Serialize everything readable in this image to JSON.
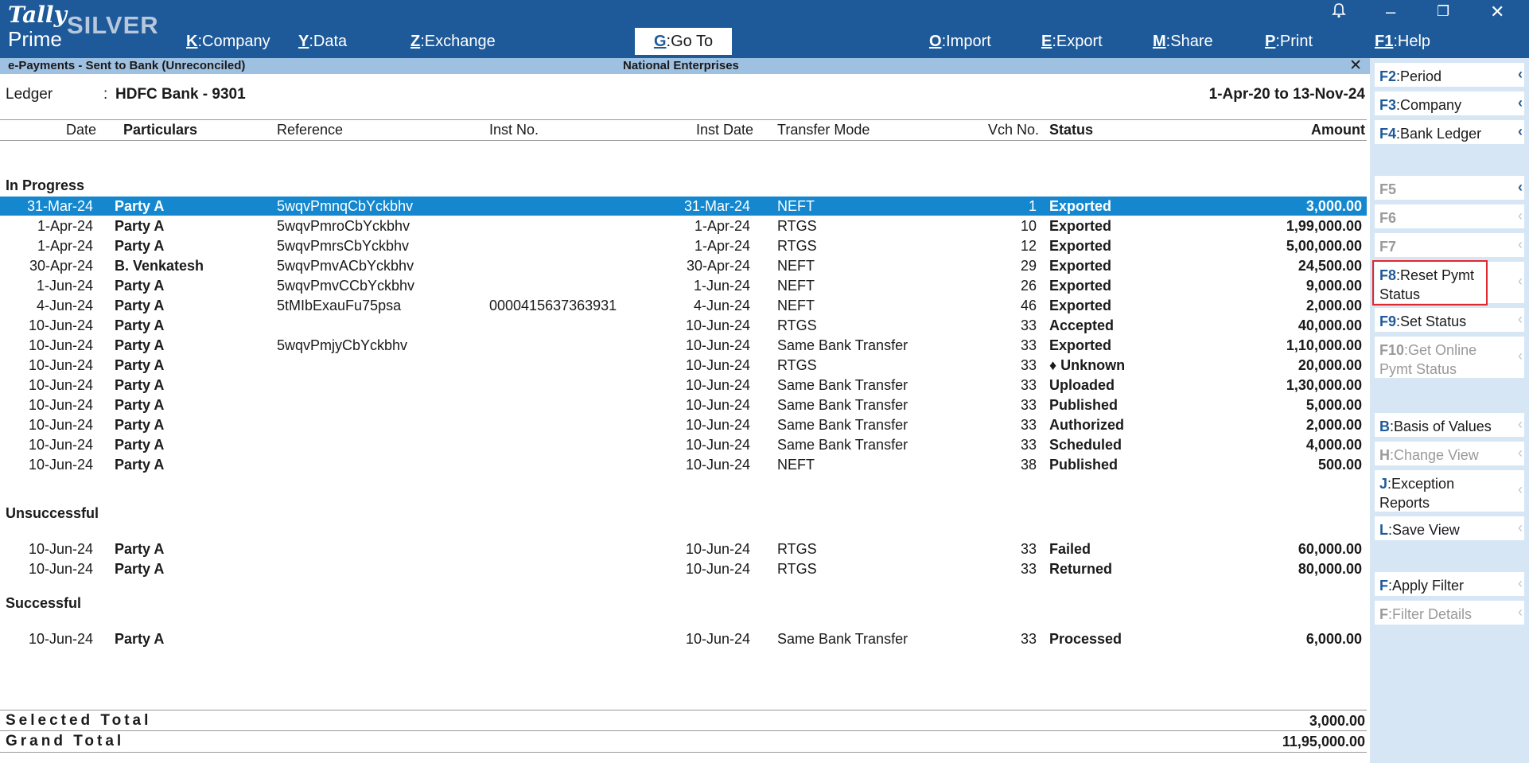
{
  "topbar": {
    "logo_tally": "Tally",
    "logo_prime": "Prime",
    "edition": "SILVER",
    "menu": [
      {
        "key": "K",
        "label": "Company"
      },
      {
        "key": "Y",
        "label": "Data"
      },
      {
        "key": "Z",
        "label": "Exchange"
      },
      {
        "key": "O",
        "label": "Import"
      },
      {
        "key": "E",
        "label": "Export"
      },
      {
        "key": "M",
        "label": "Share"
      },
      {
        "key": "P",
        "label": "Print"
      },
      {
        "key": "F1",
        "label": "Help"
      }
    ],
    "goto": {
      "key": "G",
      "label": "Go To"
    }
  },
  "titlebar": {
    "report_name": "e-Payments - Sent to Bank (Unreconciled)",
    "company": "National Enterprises"
  },
  "ledger": {
    "label": "Ledger",
    "sep": ":",
    "name": "HDFC Bank - 9301",
    "period": "1-Apr-20 to 13-Nov-24"
  },
  "columns": {
    "date": "Date",
    "particulars": "Particulars",
    "reference": "Reference",
    "inst_no": "Inst No.",
    "inst_date": "Inst Date",
    "transfer_mode": "Transfer Mode",
    "vch_no": "Vch No.",
    "status": "Status",
    "amount": "Amount"
  },
  "sections": {
    "in_progress": {
      "title": "In Progress",
      "rows": [
        {
          "date": "31-Mar-24",
          "party": "Party A",
          "ref": "5wqvPmnqCbYckbhv",
          "inst_no": "",
          "inst_date": "31-Mar-24",
          "mode": "NEFT",
          "vch": "1",
          "status": "Exported",
          "amount": "3,000.00"
        },
        {
          "date": "1-Apr-24",
          "party": "Party A",
          "ref": "5wqvPmroCbYckbhv",
          "inst_no": "",
          "inst_date": "1-Apr-24",
          "mode": "RTGS",
          "vch": "10",
          "status": "Exported",
          "amount": "1,99,000.00"
        },
        {
          "date": "1-Apr-24",
          "party": "Party A",
          "ref": "5wqvPmrsCbYckbhv",
          "inst_no": "",
          "inst_date": "1-Apr-24",
          "mode": "RTGS",
          "vch": "12",
          "status": "Exported",
          "amount": "5,00,000.00"
        },
        {
          "date": "30-Apr-24",
          "party": "B. Venkatesh",
          "ref": "5wqvPmvACbYckbhv",
          "inst_no": "",
          "inst_date": "30-Apr-24",
          "mode": "NEFT",
          "vch": "29",
          "status": "Exported",
          "amount": "24,500.00"
        },
        {
          "date": "1-Jun-24",
          "party": "Party A",
          "ref": "5wqvPmvCCbYckbhv",
          "inst_no": "",
          "inst_date": "1-Jun-24",
          "mode": "NEFT",
          "vch": "26",
          "status": "Exported",
          "amount": "9,000.00"
        },
        {
          "date": "4-Jun-24",
          "party": "Party A",
          "ref": "5tMIbExauFu75psa",
          "inst_no": "0000415637363931",
          "inst_date": "4-Jun-24",
          "mode": "NEFT",
          "vch": "46",
          "status": "Exported",
          "amount": "2,000.00"
        },
        {
          "date": "10-Jun-24",
          "party": "Party A",
          "ref": "",
          "inst_no": "",
          "inst_date": "10-Jun-24",
          "mode": "RTGS",
          "vch": "33",
          "status": "Accepted",
          "amount": "40,000.00"
        },
        {
          "date": "10-Jun-24",
          "party": "Party A",
          "ref": "5wqvPmjyCbYckbhv",
          "inst_no": "",
          "inst_date": "10-Jun-24",
          "mode": "Same Bank Transfer",
          "vch": "33",
          "status": "Exported",
          "amount": "1,10,000.00"
        },
        {
          "date": "10-Jun-24",
          "party": "Party A",
          "ref": "",
          "inst_no": "",
          "inst_date": "10-Jun-24",
          "mode": "RTGS",
          "vch": "33",
          "status": "♦ Unknown",
          "amount": "20,000.00"
        },
        {
          "date": "10-Jun-24",
          "party": "Party A",
          "ref": "",
          "inst_no": "",
          "inst_date": "10-Jun-24",
          "mode": "Same Bank Transfer",
          "vch": "33",
          "status": "Uploaded",
          "amount": "1,30,000.00"
        },
        {
          "date": "10-Jun-24",
          "party": "Party A",
          "ref": "",
          "inst_no": "",
          "inst_date": "10-Jun-24",
          "mode": "Same Bank Transfer",
          "vch": "33",
          "status": "Published",
          "amount": "5,000.00"
        },
        {
          "date": "10-Jun-24",
          "party": "Party A",
          "ref": "",
          "inst_no": "",
          "inst_date": "10-Jun-24",
          "mode": "Same Bank Transfer",
          "vch": "33",
          "status": "Authorized",
          "amount": "2,000.00"
        },
        {
          "date": "10-Jun-24",
          "party": "Party A",
          "ref": "",
          "inst_no": "",
          "inst_date": "10-Jun-24",
          "mode": "Same Bank Transfer",
          "vch": "33",
          "status": "Scheduled",
          "amount": "4,000.00"
        },
        {
          "date": "10-Jun-24",
          "party": "Party A",
          "ref": "",
          "inst_no": "",
          "inst_date": "10-Jun-24",
          "mode": "NEFT",
          "vch": "38",
          "status": "Published",
          "amount": "500.00"
        }
      ]
    },
    "unsuccessful": {
      "title": "Unsuccessful",
      "rows": [
        {
          "date": "10-Jun-24",
          "party": "Party A",
          "ref": "",
          "inst_no": "",
          "inst_date": "10-Jun-24",
          "mode": "RTGS",
          "vch": "33",
          "status": "Failed",
          "amount": "60,000.00"
        },
        {
          "date": "10-Jun-24",
          "party": "Party A",
          "ref": "",
          "inst_no": "",
          "inst_date": "10-Jun-24",
          "mode": "RTGS",
          "vch": "33",
          "status": "Returned",
          "amount": "80,000.00"
        }
      ]
    },
    "successful": {
      "title": "Successful",
      "rows": [
        {
          "date": "10-Jun-24",
          "party": "Party A",
          "ref": "",
          "inst_no": "",
          "inst_date": "10-Jun-24",
          "mode": "Same Bank Transfer",
          "vch": "33",
          "status": "Processed",
          "amount": "6,000.00"
        }
      ]
    }
  },
  "totals": {
    "selected_label": "Selected Total",
    "selected_value": "3,000.00",
    "grand_label": "Grand Total",
    "grand_value": "11,95,000.00"
  },
  "right_panel": [
    {
      "key": "F2",
      "label": "Period",
      "enabled": true
    },
    {
      "key": "F3",
      "label": "Company",
      "enabled": true
    },
    {
      "key": "F4",
      "label": "Bank Ledger",
      "enabled": true
    },
    {
      "key": "F5",
      "label": "",
      "enabled": false
    },
    {
      "key": "F6",
      "label": "",
      "enabled": false
    },
    {
      "key": "F7",
      "label": "",
      "enabled": false
    },
    {
      "key": "F8",
      "label": "Reset Pymt Status",
      "enabled": true
    },
    {
      "key": "F9",
      "label": "Set Status",
      "enabled": true
    },
    {
      "key": "F10",
      "label": "Get Online Pymt Status",
      "enabled": false
    },
    {
      "key": "B",
      "label": "Basis of Values",
      "enabled": true
    },
    {
      "key": "H",
      "label": "Change View",
      "enabled": false
    },
    {
      "key": "J",
      "label": "Exception Reports",
      "enabled": true
    },
    {
      "key": "L",
      "label": "Save View",
      "enabled": true
    },
    {
      "key": "F",
      "label": "Apply Filter",
      "enabled": true
    },
    {
      "key": "F",
      "label": "Filter Details",
      "enabled": false
    }
  ],
  "colors": {
    "topbar": "#1e5a99",
    "selected_row": "#1487cf",
    "titlebar": "#9fc1e1",
    "panel": "#d6e6f5",
    "highlight": "#e0282f"
  }
}
